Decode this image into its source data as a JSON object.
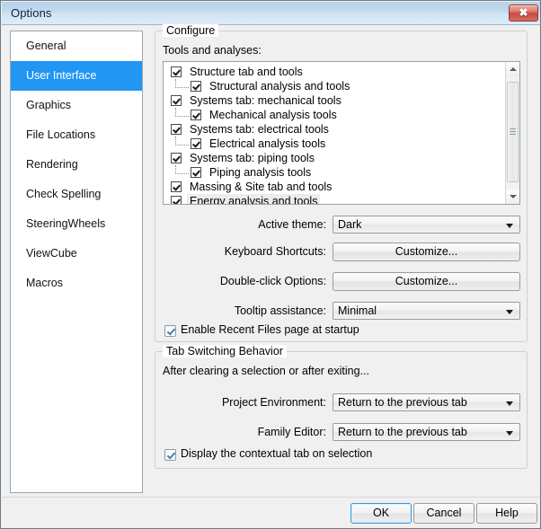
{
  "window": {
    "title": "Options",
    "close_icon": "close-icon",
    "close_glyph": "✖"
  },
  "sidebar": {
    "items": [
      {
        "label": "General",
        "selected": false
      },
      {
        "label": "User Interface",
        "selected": true
      },
      {
        "label": "Graphics",
        "selected": false
      },
      {
        "label": "File Locations",
        "selected": false
      },
      {
        "label": "Rendering",
        "selected": false
      },
      {
        "label": "Check Spelling",
        "selected": false
      },
      {
        "label": "SteeringWheels",
        "selected": false
      },
      {
        "label": "ViewCube",
        "selected": false
      },
      {
        "label": "Macros",
        "selected": false
      }
    ]
  },
  "configure": {
    "group_title": "Configure",
    "tools_label": "Tools and analyses:",
    "tree": [
      {
        "label": "Structure tab and tools",
        "level": 0,
        "checked": true,
        "selected": false
      },
      {
        "label": "Structural analysis and tools",
        "level": 1,
        "checked": true,
        "selected": false
      },
      {
        "label": "Systems tab: mechanical tools",
        "level": 0,
        "checked": true,
        "selected": false
      },
      {
        "label": "Mechanical analysis tools",
        "level": 1,
        "checked": true,
        "selected": false
      },
      {
        "label": "Systems tab: electrical tools",
        "level": 0,
        "checked": true,
        "selected": false
      },
      {
        "label": "Electrical analysis tools",
        "level": 1,
        "checked": true,
        "selected": false
      },
      {
        "label": "Systems tab: piping tools",
        "level": 0,
        "checked": true,
        "selected": false
      },
      {
        "label": "Piping analysis tools",
        "level": 1,
        "checked": true,
        "selected": false
      },
      {
        "label": "Massing & Site tab and tools",
        "level": 0,
        "checked": true,
        "selected": false
      },
      {
        "label": "Energy analysis and tools",
        "level": 0,
        "checked": true,
        "selected": true
      }
    ],
    "active_theme": {
      "label": "Active theme:",
      "value": "Dark"
    },
    "keyboard_shortcuts": {
      "label": "Keyboard Shortcuts:",
      "button": "Customize..."
    },
    "double_click_options": {
      "label": "Double-click Options:",
      "button": "Customize..."
    },
    "tooltip_assistance": {
      "label": "Tooltip assistance:",
      "value": "Minimal"
    },
    "enable_recent_files": {
      "label": "Enable Recent Files page at startup",
      "checked": true
    }
  },
  "tab_switching": {
    "group_title": "Tab Switching Behavior",
    "description": "After clearing a selection or after exiting...",
    "project_environment": {
      "label": "Project Environment:",
      "value": "Return to the previous tab"
    },
    "family_editor": {
      "label": "Family Editor:",
      "value": "Return to the previous tab"
    },
    "display_contextual_tab": {
      "label": "Display the contextual tab on selection",
      "checked": true
    }
  },
  "footer": {
    "ok": "OK",
    "cancel": "Cancel",
    "help": "Help"
  },
  "colors": {
    "selection_blue": "#2196f3",
    "titlebar_blue": "#c3d9ec",
    "close_red": "#c94a3f",
    "dialog_gray": "#f0f0f0"
  }
}
